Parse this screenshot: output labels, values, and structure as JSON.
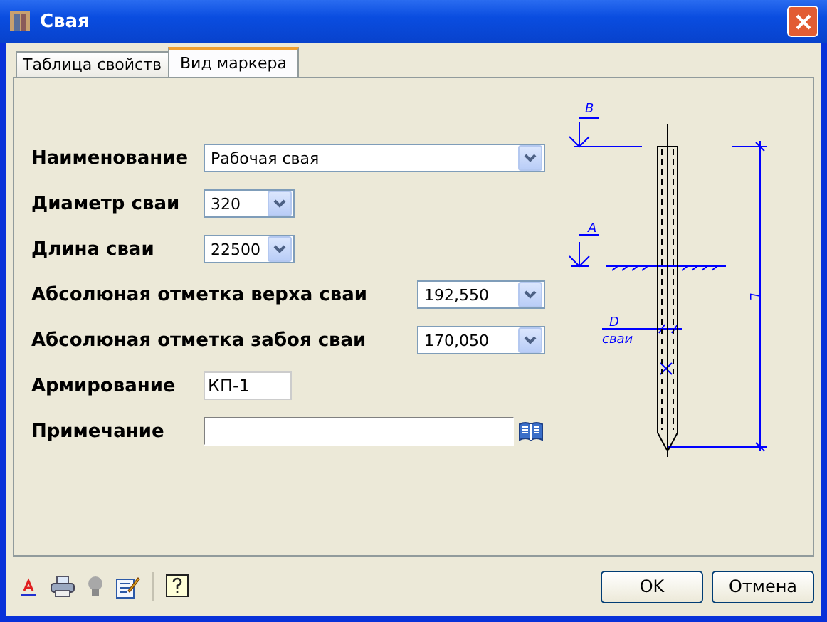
{
  "window": {
    "title": "Свая"
  },
  "tabs": [
    {
      "label": "Таблица свойств",
      "selected": false
    },
    {
      "label": "Вид маркера",
      "selected": true
    }
  ],
  "fields": [
    {
      "label": "Наименование",
      "kind": "combo",
      "value": "Рабочая свая"
    },
    {
      "label": "Диаметр сваи",
      "kind": "combo",
      "value": "320"
    },
    {
      "label": "Длина сваи",
      "kind": "combo",
      "value": "22500"
    },
    {
      "label": "Абсолюная отметка верха сваи",
      "kind": "combo",
      "value": "192,550"
    },
    {
      "label": "Абсолюная отметка забоя сваи",
      "kind": "combo",
      "value": "170,050"
    },
    {
      "label": "Армирование",
      "kind": "text",
      "value": "КП-1"
    },
    {
      "label": "Примечание",
      "kind": "book"
    }
  ],
  "diagram": {
    "top_mark": "В",
    "ground_mark": "А",
    "diameter": "D",
    "diameter_sub": "сваи",
    "length": "L"
  },
  "buttons": [
    {
      "label": "OK"
    },
    {
      "label": "Отмена"
    }
  ]
}
